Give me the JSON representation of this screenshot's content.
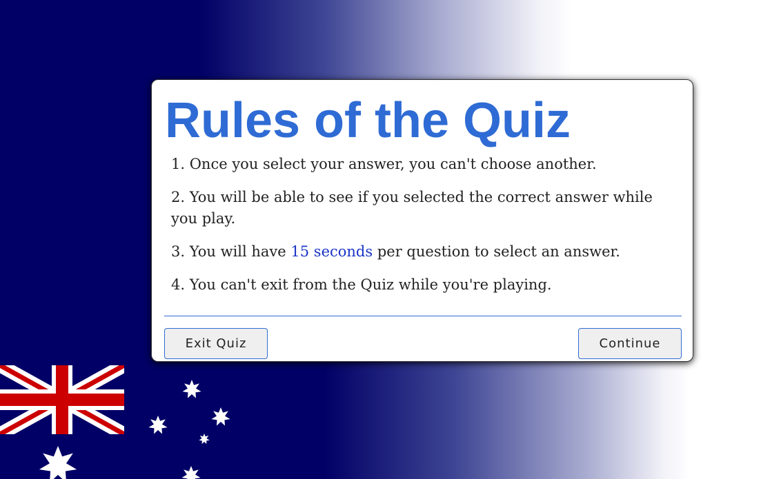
{
  "modal": {
    "title": "Rules of the Quiz",
    "rules": [
      {
        "text": "1. Once you select your answer, you can't choose another."
      },
      {
        "text": "2. You will be able to see if you selected the correct answer while you play."
      },
      {
        "before": "3. You will have ",
        "highlight": "15 seconds",
        "after": " per question to select an answer."
      },
      {
        "text": "4. You can't exit from the Quiz while you're playing."
      }
    ],
    "exit_label": "Exit Quiz",
    "continue_label": "Continue"
  },
  "colors": {
    "navy": "#010066",
    "accent_blue": "#2f6bd4",
    "flag_red": "#cc0000",
    "highlight": "#1a35c7"
  }
}
